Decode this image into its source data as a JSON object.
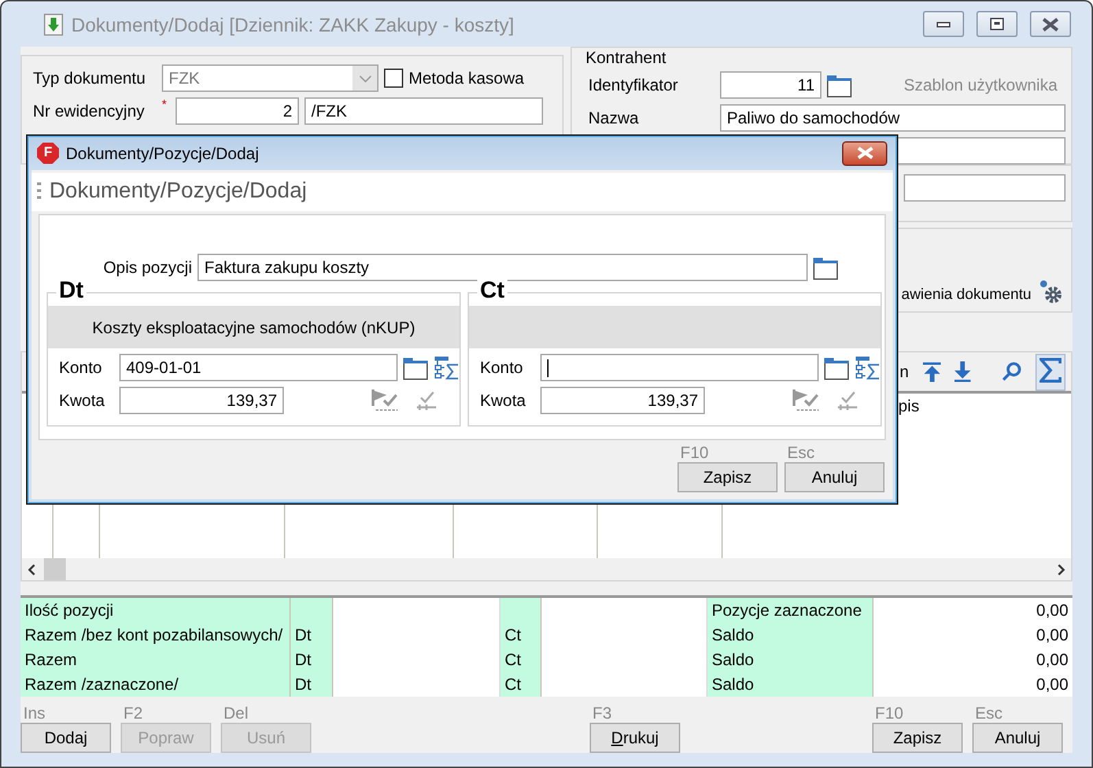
{
  "window": {
    "title": "Dokumenty/Dodaj [Dziennik: ZAKK  Zakupy - koszty]"
  },
  "document": {
    "type": {
      "label": "Typ dokumentu",
      "value": "FZK"
    },
    "cash_method": {
      "label": "Metoda kasowa",
      "checked": false
    },
    "number": {
      "label": "Nr ewidencyjny",
      "required": true,
      "required_mark": "*",
      "value": "2",
      "suffix": "/FZK"
    }
  },
  "contractor": {
    "title": "Kontrahent",
    "id": {
      "label": "Identyfikator",
      "value": "11"
    },
    "template": "Szablon użytkownika",
    "name": {
      "label": "Nazwa",
      "value": "Paliwo do samochodów"
    }
  },
  "settings_link": "awienia dokumentu",
  "grid": {
    "toolbar_label": "n",
    "column_header": "pis",
    "sigma_on": true
  },
  "summary": [
    {
      "label": "Ilość pozycji",
      "right_label": "Pozycje zaznaczone",
      "value": "0,00"
    },
    {
      "label": "Razem /bez kont pozabilansowych/",
      "dt": "Dt",
      "ct": "Ct",
      "right_label": "Saldo",
      "value": "0,00"
    },
    {
      "label": "Razem",
      "dt": "Dt",
      "ct": "Ct",
      "right_label": "Saldo",
      "value": "0,00"
    },
    {
      "label": "Razem /zaznaczone/",
      "dt": "Dt",
      "ct": "Ct",
      "right_label": "Saldo",
      "value": "0,00"
    }
  ],
  "buttons": [
    {
      "hotkey": "Ins",
      "label": "Dodaj",
      "disabled": false,
      "mnemonic": false
    },
    {
      "hotkey": "F2",
      "label": "Popraw",
      "disabled": true,
      "mnemonic": false
    },
    {
      "hotkey": "Del",
      "label": "Usuń",
      "disabled": true,
      "mnemonic": false
    },
    {
      "hotkey": "F3",
      "label": "Drukuj",
      "disabled": false,
      "mnemonic": true
    },
    {
      "hotkey": "F10",
      "label": "Zapisz",
      "disabled": false,
      "mnemonic": false
    },
    {
      "hotkey": "Esc",
      "label": "Anuluj",
      "disabled": false,
      "mnemonic": false
    }
  ],
  "dialog": {
    "icon_letter": "F",
    "title": "Dokumenty/Pozycje/Dodaj",
    "header": "Dokumenty/Pozycje/Dodaj",
    "description": {
      "label": "Opis pozycji",
      "value": "Faktura zakupu koszty"
    },
    "sides": [
      {
        "title": "Dt",
        "account_name": "Koszty eksploatacyjne samochodów (nKUP)",
        "account": {
          "label": "Konto",
          "value": "409-01-01",
          "focused": false
        },
        "amount": {
          "label": "Kwota",
          "value": "139,37"
        }
      },
      {
        "title": "Ct",
        "account": {
          "label": "Konto",
          "focused": true
        },
        "amount": {
          "label": "Kwota",
          "value": "139,37"
        }
      }
    ],
    "buttons": [
      {
        "hotkey": "F10",
        "label": "Zapisz"
      },
      {
        "hotkey": "Esc",
        "label": "Anuluj"
      }
    ]
  }
}
